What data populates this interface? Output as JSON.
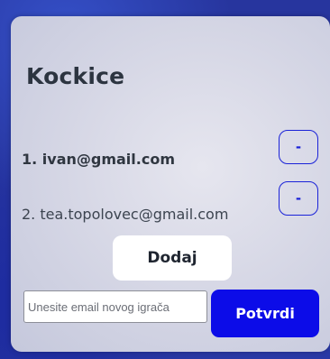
{
  "game": {
    "title": "Kockice"
  },
  "players": [
    {
      "label": "1. ivan@gmail.com",
      "remove_label": "-",
      "highlighted": true
    },
    {
      "label": "2. tea.topolovec@gmail.com",
      "remove_label": "-",
      "highlighted": false
    }
  ],
  "actions": {
    "add_label": "Dodaj",
    "email_placeholder": "Unesite email novog igrača",
    "email_value": "",
    "confirm_label": "Potvrdi"
  },
  "colors": {
    "accent": "#0c0ce8",
    "remove_border": "#1a22d8",
    "card_background": "#d7d8e6",
    "page_background": "#27359e"
  }
}
